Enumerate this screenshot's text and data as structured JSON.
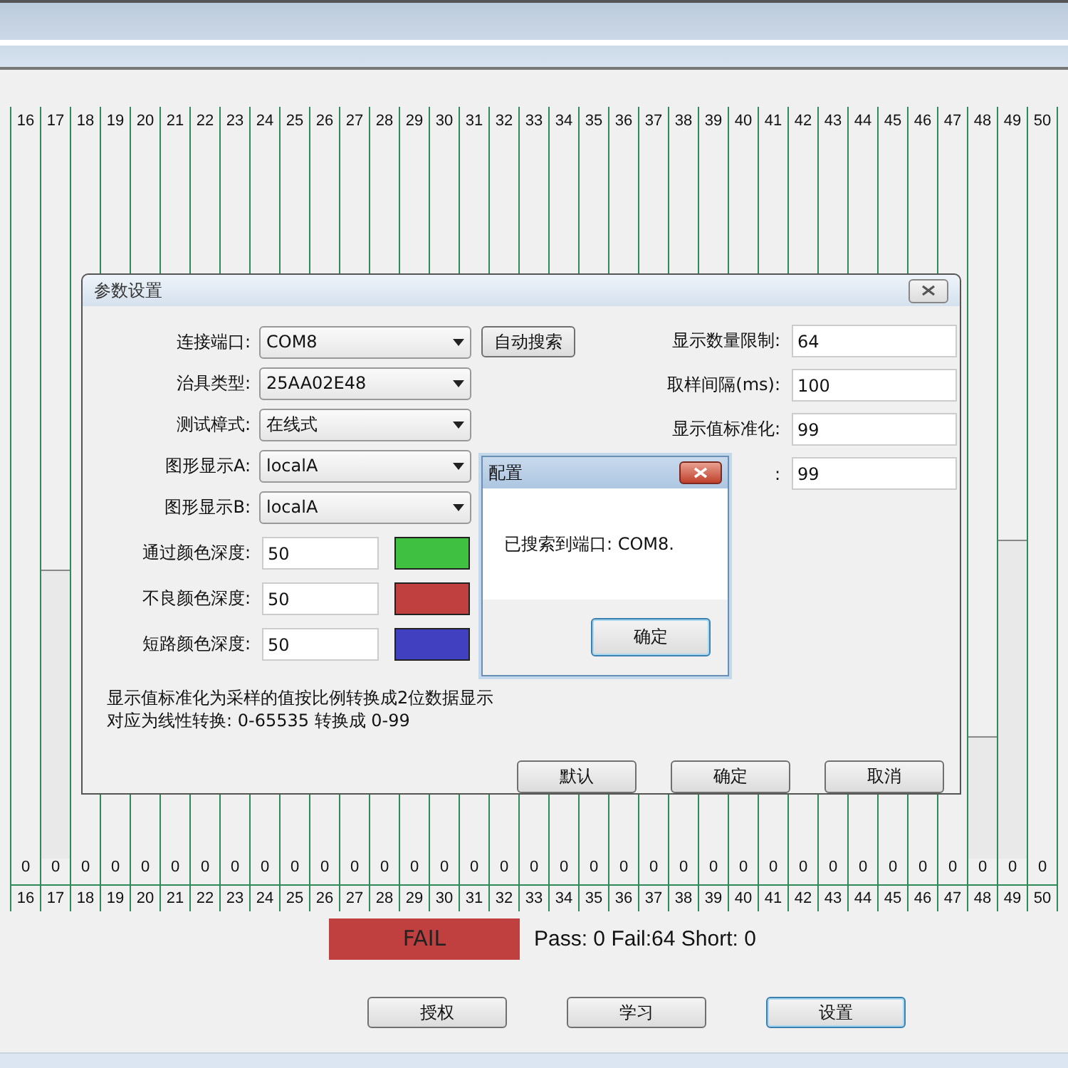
{
  "chart": {
    "columns": [
      {
        "label": "16",
        "value": "0",
        "bottom_label": "16"
      },
      {
        "label": "17",
        "value": "0",
        "bottom_label": "17",
        "level": 0.4
      },
      {
        "label": "18",
        "value": "0",
        "bottom_label": "18"
      },
      {
        "label": "19",
        "value": "0",
        "bottom_label": "19"
      },
      {
        "label": "20",
        "value": "0",
        "bottom_label": "20"
      },
      {
        "label": "21",
        "value": "0",
        "bottom_label": "21"
      },
      {
        "label": "22",
        "value": "0",
        "bottom_label": "22"
      },
      {
        "label": "23",
        "value": "0",
        "bottom_label": "23"
      },
      {
        "label": "24",
        "value": "0",
        "bottom_label": "24"
      },
      {
        "label": "25",
        "value": "0",
        "bottom_label": "25"
      },
      {
        "label": "26",
        "value": "0",
        "bottom_label": "26"
      },
      {
        "label": "27",
        "value": "0",
        "bottom_label": "27"
      },
      {
        "label": "28",
        "value": "0",
        "bottom_label": "28"
      },
      {
        "label": "29",
        "value": "0",
        "bottom_label": "29"
      },
      {
        "label": "30",
        "value": "0",
        "bottom_label": "30"
      },
      {
        "label": "31",
        "value": "0",
        "bottom_label": "31"
      },
      {
        "label": "32",
        "value": "0",
        "bottom_label": "32"
      },
      {
        "label": "33",
        "value": "0",
        "bottom_label": "33"
      },
      {
        "label": "34",
        "value": "0",
        "bottom_label": "34"
      },
      {
        "label": "35",
        "value": "0",
        "bottom_label": "35"
      },
      {
        "label": "36",
        "value": "0",
        "bottom_label": "36"
      },
      {
        "label": "37",
        "value": "0",
        "bottom_label": "37"
      },
      {
        "label": "38",
        "value": "0",
        "bottom_label": "38"
      },
      {
        "label": "39",
        "value": "0",
        "bottom_label": "39"
      },
      {
        "label": "40",
        "value": "0",
        "bottom_label": "40"
      },
      {
        "label": "41",
        "value": "0",
        "bottom_label": "41"
      },
      {
        "label": "42",
        "value": "0",
        "bottom_label": "42"
      },
      {
        "label": "43",
        "value": "0",
        "bottom_label": "43"
      },
      {
        "label": "44",
        "value": "0",
        "bottom_label": "44"
      },
      {
        "label": "45",
        "value": "0",
        "bottom_label": "45"
      },
      {
        "label": "46",
        "value": "0",
        "bottom_label": "46"
      },
      {
        "label": "47",
        "value": "0",
        "bottom_label": "47"
      },
      {
        "label": "48",
        "value": "0",
        "bottom_label": "48",
        "level": 0.17
      },
      {
        "label": "49",
        "value": "0",
        "bottom_label": "49",
        "level": 0.44
      },
      {
        "label": "50",
        "value": "0",
        "bottom_label": "50"
      }
    ]
  },
  "status": {
    "result": "FAIL",
    "summary": "Pass:  0 Fail:64 Short:  0"
  },
  "buttons": [
    {
      "label": "授权",
      "focused": false
    },
    {
      "label": "学习",
      "focused": false
    },
    {
      "label": "设置",
      "focused": true
    }
  ],
  "settings_dialog": {
    "title": "参数设置",
    "selects": [
      {
        "label": "连接端口:",
        "value": "COM8"
      },
      {
        "label": "治具类型:",
        "value": "25AA02E48"
      },
      {
        "label": "测试樟式:",
        "value": "在线式"
      },
      {
        "label": "图形显示A:",
        "value": "localA"
      },
      {
        "label": "图形显示B:",
        "value": "localA"
      }
    ],
    "search_button": "自动搜索",
    "fields": [
      {
        "label": "显示数量限制:",
        "value": "64"
      },
      {
        "label": "取样间隔(ms):",
        "value": "100"
      },
      {
        "label": "显示值标准化:",
        "value": "99"
      },
      {
        "label": ":",
        "value": "99"
      }
    ],
    "colors": [
      {
        "label": "通过颜色深度:",
        "value": "50",
        "color": "#40c040"
      },
      {
        "label": "不良颜色深度:",
        "value": "50",
        "color": "#c04040"
      },
      {
        "label": "短路颜色深度:",
        "value": "50",
        "color": "#4040c0"
      }
    ],
    "notes": [
      "显示值标准化为采样的值按比例转换成2位数据显示",
      "对应为线性转换: 0-65535 转换成 0-99"
    ],
    "buttons": [
      "默认",
      "确定",
      "取消"
    ]
  },
  "message_box": {
    "title": "配置",
    "message": "已搜索到端口: COM8.",
    "button": "确定"
  }
}
